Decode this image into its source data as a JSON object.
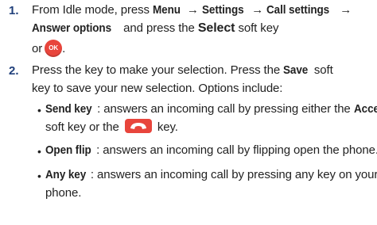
{
  "steps": [
    {
      "number": "1.",
      "t1": "From Idle mode, press ",
      "menu": "Menu",
      "arrow": " → ",
      "settings": "Settings",
      "call_settings": "Call settings",
      "answer_options": "Answer options",
      "t2": " and press the ",
      "select": "Select",
      "t3": " soft key",
      "or": "or",
      "ok_label": "OK",
      "period": "."
    },
    {
      "number": "2.",
      "t1": "Press the key to make your selection. Press the ",
      "save": "Save",
      "t2": " soft",
      "t3": "key to save your new selection. Options include:"
    }
  ],
  "options": [
    {
      "term": "Send key",
      "d1": ": answers an incoming call by pressing either the ",
      "accept": "Accept",
      "d2": "soft key or the ",
      "d3": " key."
    },
    {
      "term": "Open flip",
      "d1": ": answers an incoming call by flipping open the phone."
    },
    {
      "term": "Any key",
      "d1": ": answers an incoming call by pressing any key on your",
      "d2": "phone."
    }
  ],
  "colors": {
    "number": "#1f3f7a",
    "key_icon": "#e8453c"
  },
  "icons": {
    "ok": "ok-key-icon",
    "send": "send-key-icon"
  }
}
